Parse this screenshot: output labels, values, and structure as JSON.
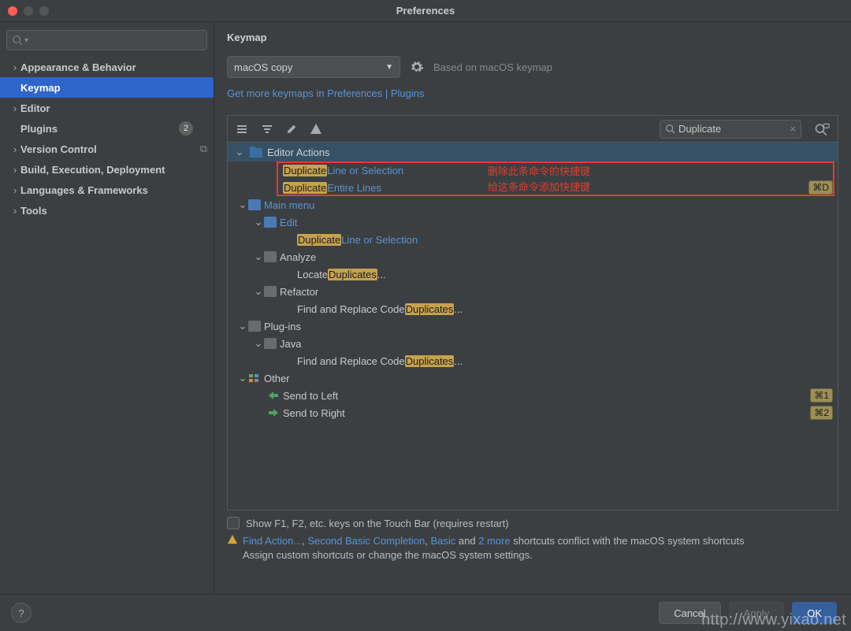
{
  "window": {
    "title": "Preferences"
  },
  "sidebar": {
    "search_placeholder": "",
    "items": [
      {
        "label": "Appearance & Behavior",
        "expandable": true
      },
      {
        "label": "Keymap",
        "selected": true
      },
      {
        "label": "Editor",
        "expandable": true
      },
      {
        "label": "Plugins",
        "badge": "2"
      },
      {
        "label": "Version Control",
        "expandable": true,
        "rightIcon": "clipboard"
      },
      {
        "label": "Build, Execution, Deployment",
        "expandable": true
      },
      {
        "label": "Languages & Frameworks",
        "expandable": true
      },
      {
        "label": "Tools",
        "expandable": true
      }
    ]
  },
  "header": {
    "title": "Keymap"
  },
  "keymap": {
    "selected": "macOS copy",
    "based_on": "Based on macOS keymap",
    "get_more": "Get more keymaps in Preferences | Plugins",
    "search_value": "Duplicate"
  },
  "tree": {
    "root_label": "Editor Actions",
    "duplicate_line": {
      "hl": "Duplicate",
      "rest": " Line or Selection"
    },
    "duplicate_entire": {
      "hl": "Duplicate",
      "rest": " Entire Lines",
      "shortcut": "⌘D"
    },
    "main_menu": "Main menu",
    "edit": "Edit",
    "edit_dup": {
      "hl": "Duplicate",
      "rest": " Line or Selection"
    },
    "analyze": "Analyze",
    "analyze_item": {
      "pre": "Locate ",
      "hl": "Duplicates",
      "post": "..."
    },
    "refactor": "Refactor",
    "refactor_item": {
      "pre": "Find and Replace Code ",
      "hl": "Duplicates",
      "post": "..."
    },
    "plugins": "Plug-ins",
    "java": "Java",
    "java_item": {
      "pre": "Find and Replace Code ",
      "hl": "Duplicates",
      "post": "..."
    },
    "other": "Other",
    "send_left": {
      "label": "Send to Left",
      "shortcut": "⌘1"
    },
    "send_right": {
      "label": "Send to Right",
      "shortcut": "⌘2"
    }
  },
  "annotations": {
    "line1": "删除此条命令的快捷键",
    "line2": "给这条命令添加快捷键"
  },
  "footer": {
    "touchbar": "Show F1, F2, etc. keys on the Touch Bar (requires restart)",
    "warn_links": {
      "a": "Find Action...",
      "b": "Second Basic Completion",
      "c": "Basic",
      "d": "2 more"
    },
    "warn_mid1": ", ",
    "warn_mid2": ", ",
    "warn_mid3": " and ",
    "warn_tail": " shortcuts conflict with the macOS system shortcuts",
    "warn_line2": "Assign custom shortcuts or change the macOS system settings.",
    "cancel": "Cancel",
    "apply": "Apply",
    "ok": "OK"
  },
  "watermark": "http://www.yixao.net"
}
